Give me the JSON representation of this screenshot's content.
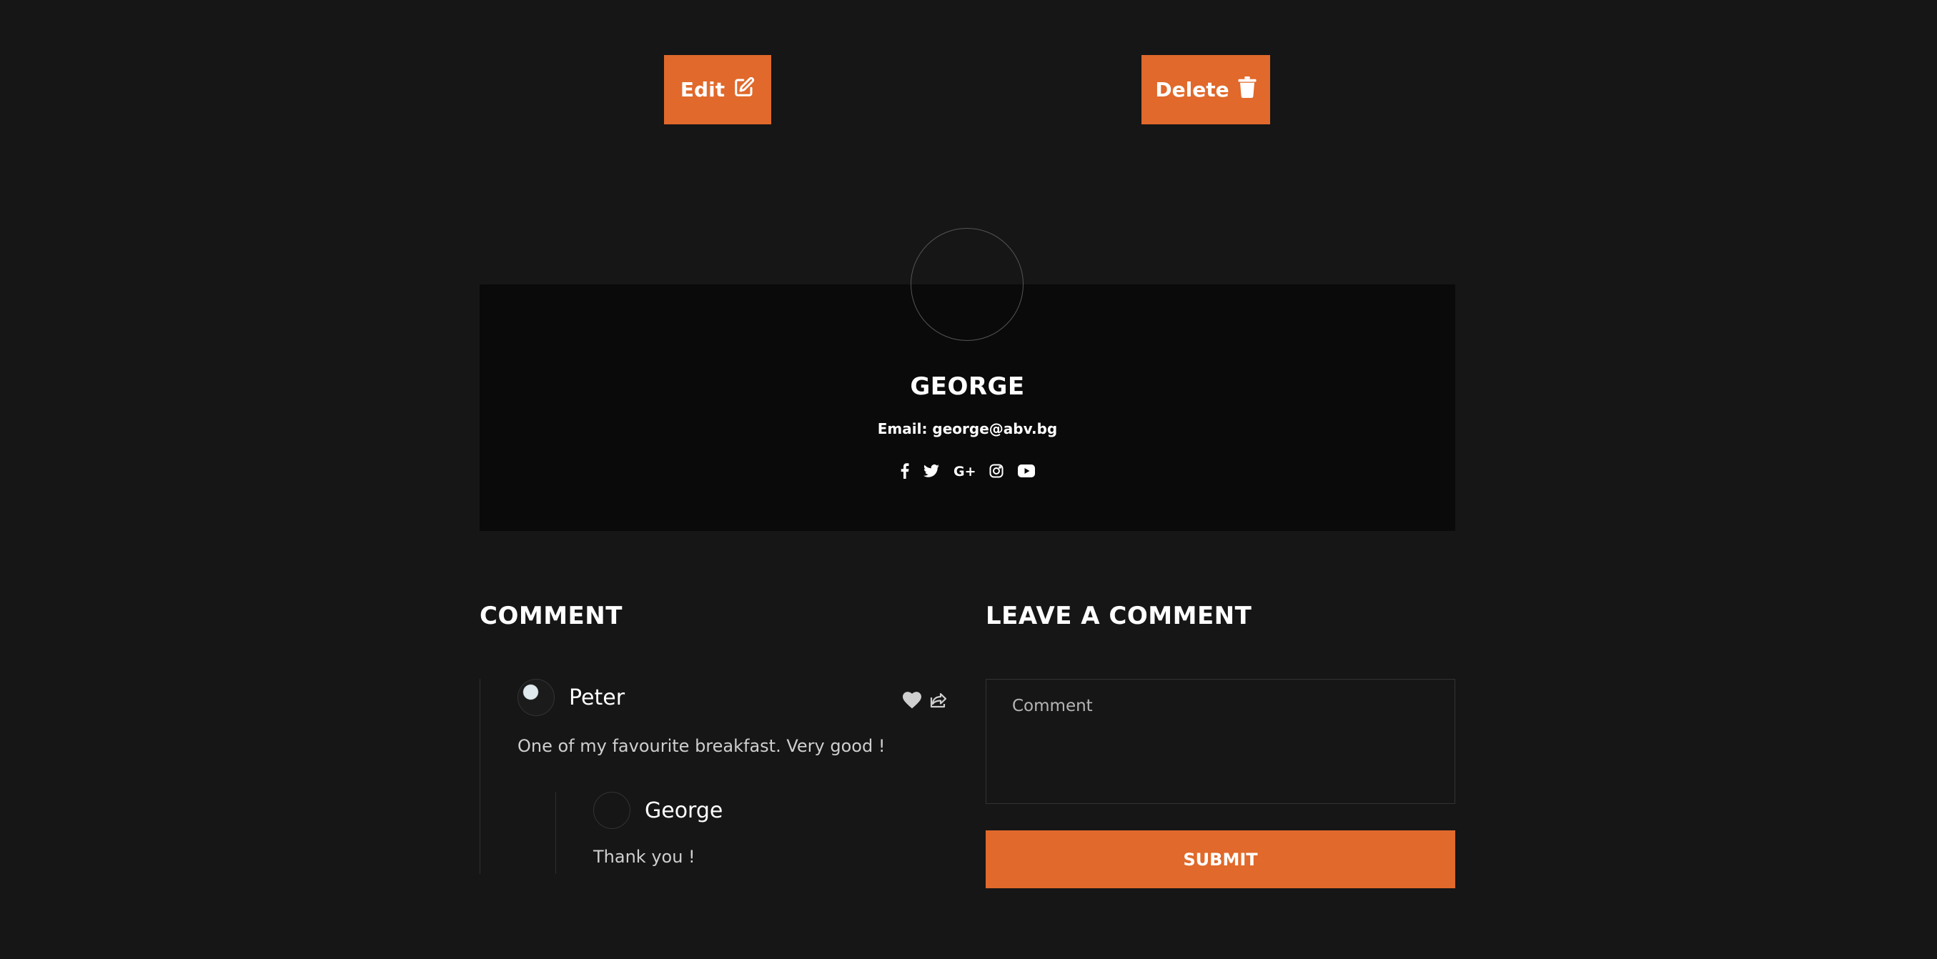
{
  "actions": {
    "edit_label": "Edit",
    "delete_label": "Delete"
  },
  "profile": {
    "name": "GEORGE",
    "email_line": "Email: george@abv.bg",
    "social": [
      "facebook-icon",
      "twitter-icon",
      "google-plus-icon",
      "instagram-icon",
      "youtube-icon"
    ]
  },
  "comments_section": {
    "title": "COMMENT",
    "comments": [
      {
        "author": "Peter",
        "text": "One of my favourite breakfast. Very good !",
        "replies": [
          {
            "author": "George",
            "text": "Thank you !"
          }
        ]
      }
    ]
  },
  "comment_form": {
    "title": "LEAVE A COMMENT",
    "placeholder": "Comment",
    "submit_label": "SUBMIT"
  },
  "colors": {
    "accent": "#e0692b",
    "background": "#161616",
    "card": "#0a0a0a"
  }
}
